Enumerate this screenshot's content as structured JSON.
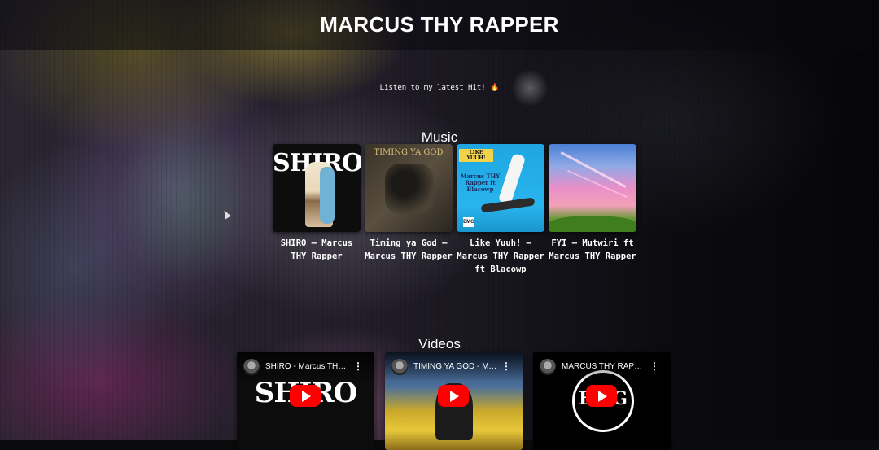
{
  "header": {
    "title": "MARCUS THY RAPPER"
  },
  "tagline": "Listen to my latest Hit! 🔥",
  "music": {
    "heading": "Music",
    "tracks": [
      {
        "title": "SHIRO – Marcus THY Rapper",
        "cover_text": "SHIRO"
      },
      {
        "title": "Timing ya God – Marcus THY Rapper",
        "cover_text": "TIMING YA GOD"
      },
      {
        "title": "Like Yuuh! – Marcus THY Rapper ft Blacowp",
        "cover_text": "LIKE YUUH!",
        "cover_subtext": "Marcus THY Rapper ft Blacowp",
        "cover_logo": "EMG"
      },
      {
        "title": "FYI – Mutwiri ft Marcus THY Rapper"
      }
    ]
  },
  "videos": {
    "heading": "Videos",
    "items": [
      {
        "title": "SHIRO - Marcus THY Rapper",
        "thumb_text": "SHIRO"
      },
      {
        "title": "TIMING YA GOD - Marcus THY Rapper"
      },
      {
        "title": "MARCUS THY RAPPER",
        "thumb_text": "EMG"
      }
    ]
  },
  "colors": {
    "play_button": "#ff0000",
    "background": "#0b0b0d",
    "text": "#ffffff"
  },
  "icons": [
    "play-icon",
    "more-vert-icon",
    "channel-avatar",
    "cursor-pointer-icon"
  ]
}
